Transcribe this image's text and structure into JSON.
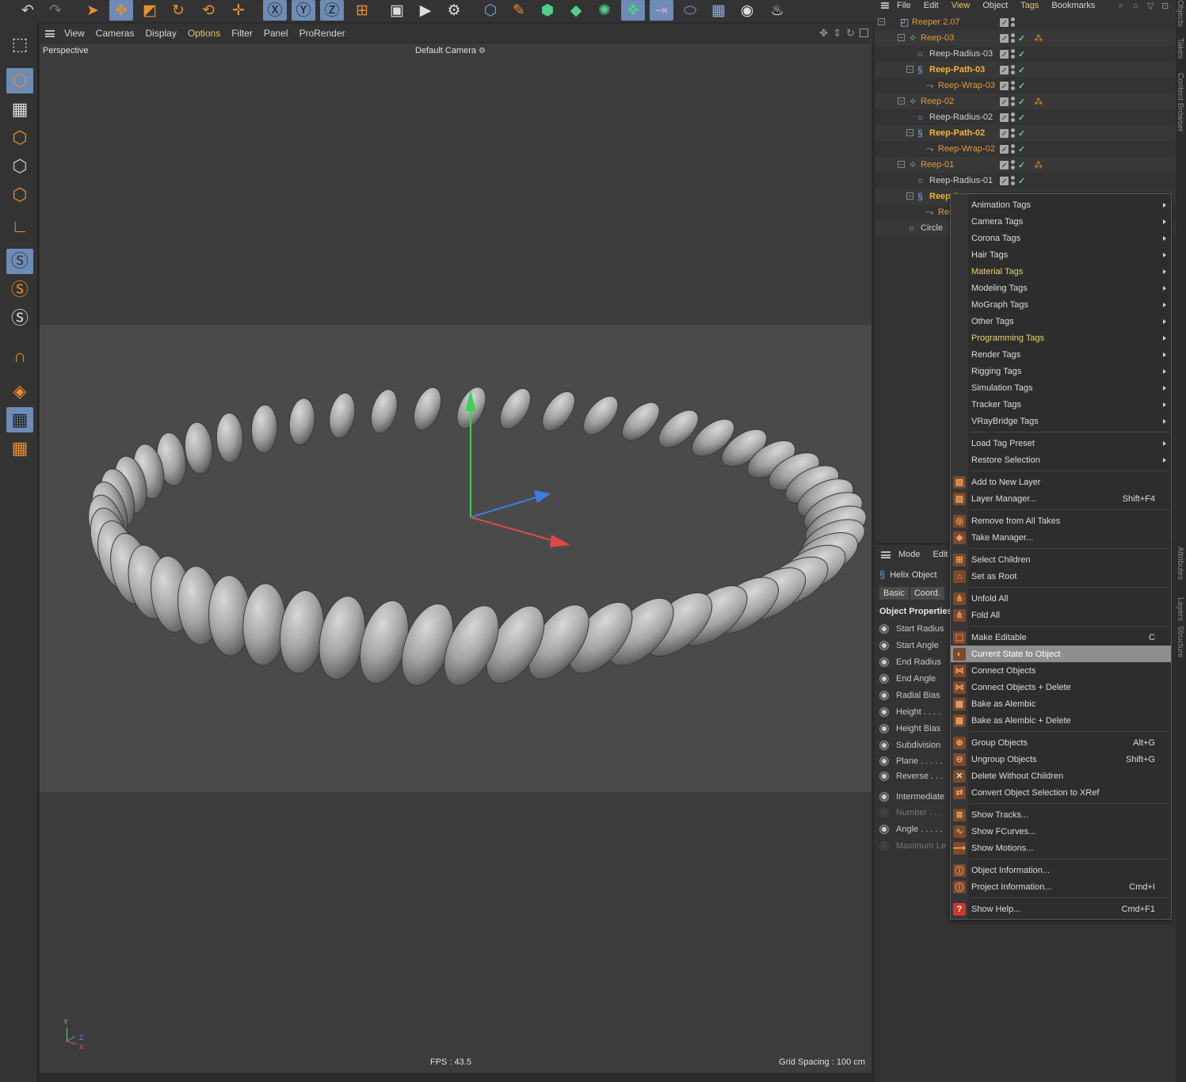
{
  "toolbar": {
    "icons": [
      "undo-icon",
      "redo-icon",
      "select-icon",
      "move-icon",
      "scale-icon",
      "rotate-icon",
      "last-tool-icon",
      "axis-icon",
      "x-axis-icon",
      "y-axis-icon",
      "z-axis-icon",
      "coordinate-system-icon",
      "render-region-icon",
      "render-view-icon",
      "render-settings-icon",
      "cube-icon",
      "pen-icon",
      "subdivision-icon",
      "extrude-icon",
      "mograph-icon",
      "cloner-icon",
      "deformer-icon",
      "effector-icon",
      "floor-icon",
      "camera-icon",
      "light-icon"
    ]
  },
  "viewport": {
    "menu": [
      "View",
      "Cameras",
      "Display",
      "Options",
      "Filter",
      "Panel",
      "ProRender"
    ],
    "active_menu": "Options",
    "camera_mode": "Perspective",
    "camera_name": "Default Camera",
    "fps": "FPS : 43.5",
    "grid_spacing": "Grid Spacing : 100 cm",
    "axis_labels": {
      "y": "Y",
      "z": "Z",
      "x": "X"
    }
  },
  "object_manager": {
    "menu": [
      "File",
      "Edit",
      "View",
      "Object",
      "Tags",
      "Bookmarks"
    ],
    "active_menus": [
      "View",
      "Tags"
    ],
    "rows": [
      {
        "name": "Reeper 2.07",
        "style": "orange",
        "indent": 0,
        "icon": "null-object-icon",
        "material": false
      },
      {
        "name": "Reep-03",
        "style": "orange",
        "indent": 1,
        "icon": "cloner-icon",
        "material": true
      },
      {
        "name": "Reep-Radius-03",
        "style": "white",
        "indent": 2,
        "icon": "circle-spline-icon",
        "material": false
      },
      {
        "name": "Reep-Path-03",
        "style": "yellow",
        "indent": 2,
        "icon": "helix-icon",
        "material": false
      },
      {
        "name": "Reep-Wrap-03",
        "style": "orange",
        "indent": 3,
        "icon": "sweep-icon",
        "material": false
      },
      {
        "name": "Reep-02",
        "style": "orange",
        "indent": 1,
        "icon": "cloner-icon",
        "material": true
      },
      {
        "name": "Reep-Radius-02",
        "style": "white",
        "indent": 2,
        "icon": "circle-spline-icon",
        "material": false
      },
      {
        "name": "Reep-Path-02",
        "style": "yellow",
        "indent": 2,
        "icon": "helix-icon",
        "material": false
      },
      {
        "name": "Reep-Wrap-02",
        "style": "orange",
        "indent": 3,
        "icon": "sweep-icon",
        "material": false
      },
      {
        "name": "Reep-01",
        "style": "orange",
        "indent": 1,
        "icon": "cloner-icon",
        "material": true
      },
      {
        "name": "Reep-Radius-01",
        "style": "white",
        "indent": 2,
        "icon": "circle-spline-icon",
        "material": false
      },
      {
        "name": "Reep-P",
        "style": "yellow",
        "indent": 2,
        "icon": "helix-icon",
        "material": false
      },
      {
        "name": "Reep",
        "style": "orange",
        "indent": 3,
        "icon": "sweep-icon",
        "material": false
      },
      {
        "name": "Circle",
        "style": "white",
        "indent": 1,
        "icon": "circle-spline-icon",
        "material": false
      }
    ]
  },
  "attribute_manager": {
    "menu": [
      "Mode",
      "Edit"
    ],
    "object_title": "Helix Object",
    "tabs": [
      "Basic",
      "Coord."
    ],
    "section": "Object Properties",
    "props": [
      {
        "label": "Start Radius",
        "dim": false
      },
      {
        "label": "Start Angle",
        "dim": false
      },
      {
        "label": "End Radius",
        "dim": false
      },
      {
        "label": "End Angle",
        "dim": false
      },
      {
        "label": "Radial Bias",
        "dim": false
      },
      {
        "label": "Height . . . .",
        "dim": false
      },
      {
        "label": "Height Bias",
        "dim": false
      },
      {
        "label": "Subdivision",
        "dim": false
      },
      {
        "label": "Plane . . . . .",
        "dim": false
      },
      {
        "label": "Reverse . . .",
        "dim": false
      },
      {
        "label": "Intermediate",
        "dim": false
      },
      {
        "label": "Number . . .",
        "dim": true
      },
      {
        "label": "Angle . . . . .",
        "dim": false
      },
      {
        "label": "Maximum Le",
        "dim": true
      }
    ]
  },
  "right_tabs": [
    "Objects",
    "Takes",
    "Content Browser",
    "Attributes",
    "Layers",
    "Structure"
  ],
  "context_menu": {
    "groups": [
      [
        {
          "label": "Animation Tags",
          "submenu": true
        },
        {
          "label": "Camera Tags",
          "submenu": true
        },
        {
          "label": "Corona Tags",
          "submenu": true
        },
        {
          "label": "Hair Tags",
          "submenu": true
        },
        {
          "label": "Material Tags",
          "submenu": true,
          "accent": true
        },
        {
          "label": "Modeling Tags",
          "submenu": true
        },
        {
          "label": "MoGraph Tags",
          "submenu": true
        },
        {
          "label": "Other Tags",
          "submenu": true
        },
        {
          "label": "Programming Tags",
          "submenu": true,
          "accent": true
        },
        {
          "label": "Render Tags",
          "submenu": true
        },
        {
          "label": "Rigging Tags",
          "submenu": true
        },
        {
          "label": "Simulation Tags",
          "submenu": true
        },
        {
          "label": "Tracker Tags",
          "submenu": true
        },
        {
          "label": "VRayBridge Tags",
          "submenu": true
        }
      ],
      [
        {
          "label": "Load Tag Preset",
          "submenu": true
        },
        {
          "label": "Restore Selection",
          "submenu": true
        }
      ],
      [
        {
          "label": "Add to New Layer",
          "icon": "layer-icon"
        },
        {
          "label": "Layer Manager...",
          "icon": "layer-manager-icon",
          "shortcut": "Shift+F4"
        }
      ],
      [
        {
          "label": "Remove from All Takes",
          "icon": "take-remove-icon"
        },
        {
          "label": "Take Manager...",
          "icon": "take-manager-icon"
        }
      ],
      [
        {
          "label": "Select Children",
          "icon": "select-children-icon"
        },
        {
          "label": "Set as Root",
          "icon": "set-root-icon"
        }
      ],
      [
        {
          "label": "Unfold All",
          "icon": "unfold-icon"
        },
        {
          "label": "Fold All",
          "icon": "fold-icon"
        }
      ],
      [
        {
          "label": "Make Editable",
          "icon": "make-editable-icon",
          "shortcut": "C"
        },
        {
          "label": "Current State to Object",
          "icon": "current-state-icon",
          "highlight": true
        },
        {
          "label": "Connect Objects",
          "icon": "connect-icon"
        },
        {
          "label": "Connect Objects + Delete",
          "icon": "connect-delete-icon"
        },
        {
          "label": "Bake as Alembic",
          "icon": "alembic-icon"
        },
        {
          "label": "Bake as Alembic + Delete",
          "icon": "alembic-delete-icon"
        }
      ],
      [
        {
          "label": "Group Objects",
          "icon": "group-icon",
          "shortcut": "Alt+G"
        },
        {
          "label": "Ungroup Objects",
          "icon": "ungroup-icon",
          "shortcut": "Shift+G"
        },
        {
          "label": "Delete Without Children",
          "icon": "delete-icon"
        },
        {
          "label": "Convert Object Selection to XRef",
          "icon": "xref-icon"
        }
      ],
      [
        {
          "label": "Show Tracks...",
          "icon": "tracks-icon"
        },
        {
          "label": "Show FCurves...",
          "icon": "fcurves-icon"
        },
        {
          "label": "Show Motions...",
          "icon": "motions-icon"
        }
      ],
      [
        {
          "label": "Object Information...",
          "icon": "info-icon"
        },
        {
          "label": "Project Information...",
          "icon": "project-info-icon",
          "shortcut": "Cmd+I"
        }
      ],
      [
        {
          "label": "Show Help...",
          "icon": "help-icon",
          "shortcut": "Cmd+F1"
        }
      ]
    ]
  },
  "colors": {
    "accent": "#e8c36b",
    "selection": "#6d8bb5",
    "orange": "#e39a3d",
    "highlight": "#8e8e8e"
  }
}
